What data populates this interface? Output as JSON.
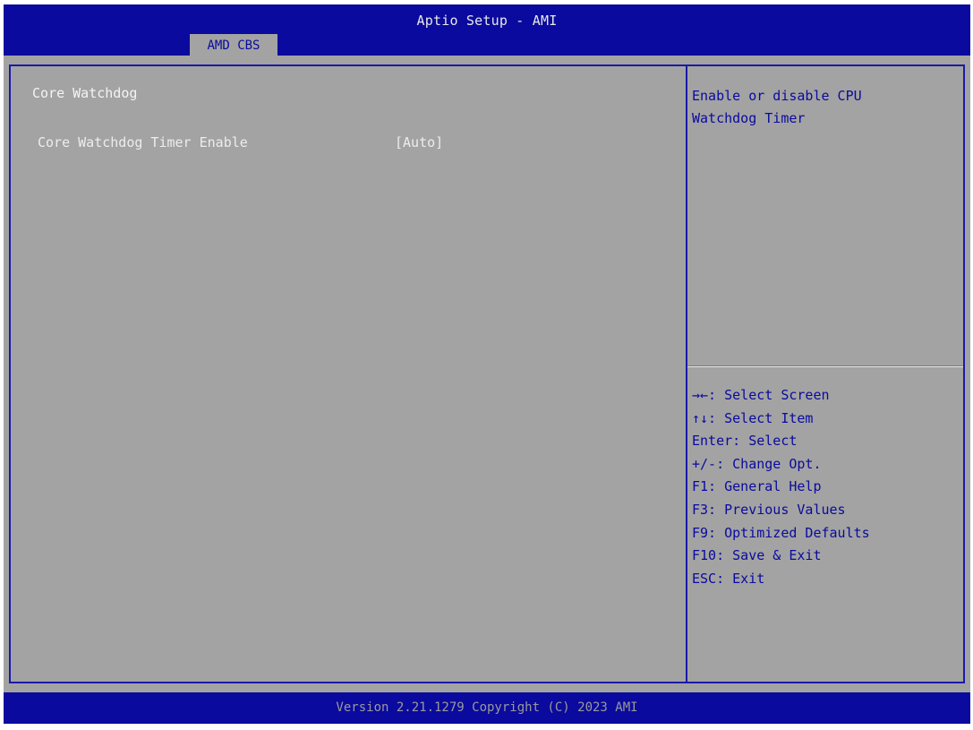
{
  "header": {
    "title": "Aptio Setup - AMI",
    "active_tab": "AMD CBS"
  },
  "main": {
    "section_title": "Core Watchdog",
    "settings": [
      {
        "label": "Core Watchdog Timer Enable",
        "value": "[Auto]"
      }
    ]
  },
  "help": {
    "line1": "Enable or disable CPU",
    "line2": "Watchdog Timer"
  },
  "keys": [
    "→←: Select Screen",
    "↑↓: Select Item",
    "Enter: Select",
    "+/-: Change Opt.",
    "F1: General Help",
    "F3: Previous Values",
    "F9: Optimized Defaults",
    "F10: Save & Exit",
    "ESC: Exit"
  ],
  "footer": {
    "text": "Version 2.21.1279 Copyright (C) 2023 AMI"
  },
  "colors": {
    "bios_blue": "#0a0a9e",
    "panel_gray": "#a3a3a3",
    "text_white": "#ededed"
  }
}
